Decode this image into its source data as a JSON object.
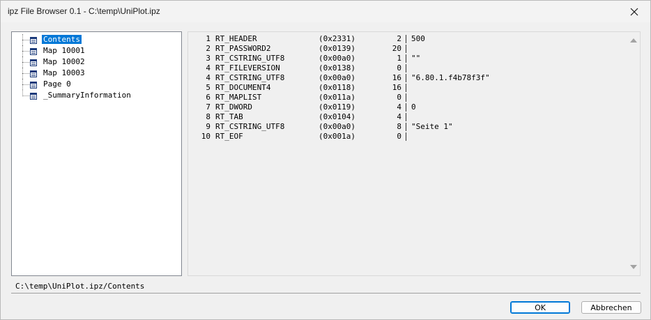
{
  "window": {
    "title": "ipz File Browser 0.1 - C:\\temp\\UniPlot.ipz"
  },
  "tree": {
    "items": [
      {
        "label": "Contents",
        "selected": true
      },
      {
        "label": "Map 10001",
        "selected": false
      },
      {
        "label": "Map 10002",
        "selected": false
      },
      {
        "label": "Map 10003",
        "selected": false
      },
      {
        "label": "Page 0",
        "selected": false
      },
      {
        "label": "_SummaryInformation",
        "selected": false
      }
    ]
  },
  "records": [
    {
      "idx": "1",
      "name": "RT_HEADER",
      "code": "(0x2331)",
      "len": "2",
      "value": "500"
    },
    {
      "idx": "2",
      "name": "RT_PASSWORD2",
      "code": "(0x0139)",
      "len": "20",
      "value": ""
    },
    {
      "idx": "3",
      "name": "RT_CSTRING_UTF8",
      "code": "(0x00a0)",
      "len": "1",
      "value": "\"\""
    },
    {
      "idx": "4",
      "name": "RT_FILEVERSION",
      "code": "(0x0138)",
      "len": "0",
      "value": ""
    },
    {
      "idx": "4",
      "name": "RT_CSTRING_UTF8",
      "code": "(0x00a0)",
      "len": "16",
      "value": "\"6.80.1.f4b78f3f\""
    },
    {
      "idx": "5",
      "name": "RT_DOCUMENT4",
      "code": "(0x0118)",
      "len": "16",
      "value": ""
    },
    {
      "idx": "6",
      "name": "RT_MAPLIST",
      "code": "(0x011a)",
      "len": "0",
      "value": ""
    },
    {
      "idx": "7",
      "name": "RT_DWORD",
      "code": "(0x0119)",
      "len": "4",
      "value": "0"
    },
    {
      "idx": "8",
      "name": "RT_TAB",
      "code": "(0x0104)",
      "len": "4",
      "value": ""
    },
    {
      "idx": "9",
      "name": "RT_CSTRING_UTF8",
      "code": "(0x00a0)",
      "len": "8",
      "value": "\"Seite 1\""
    },
    {
      "idx": "10",
      "name": "RT_EOF",
      "code": "(0x001a)",
      "len": "0",
      "value": ""
    }
  ],
  "status": {
    "path": "C:\\temp\\UniPlot.ipz/Contents"
  },
  "buttons": {
    "ok_label": "OK",
    "cancel_label": "Abbrechen"
  },
  "icons": {
    "close": "close-icon",
    "tree_node": "table-icon",
    "scroll_up": "scroll-up-arrow-icon",
    "scroll_down": "scroll-down-arrow-icon"
  },
  "colors": {
    "selection": "#0078d7",
    "default_button_border": "#0078d7"
  }
}
